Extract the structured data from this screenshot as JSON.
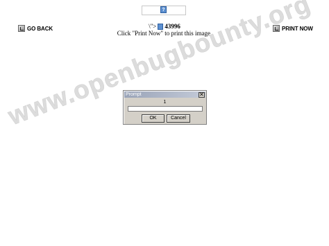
{
  "top_image": {
    "icon": "broken-image-icon"
  },
  "nav": {
    "go_back_label": "GO BACK",
    "print_now_label": "PRINT NOW"
  },
  "content": {
    "prefix": "\\\">",
    "number": "43996",
    "instruction": "Click \"Print Now\" to print this image."
  },
  "watermark": "www.openbugbounty.org",
  "prompt_dialog": {
    "title": "Prompt",
    "close_glyph": "✕",
    "message": "1",
    "input_value": "",
    "ok_label": "OK",
    "cancel_label": "Cancel"
  }
}
